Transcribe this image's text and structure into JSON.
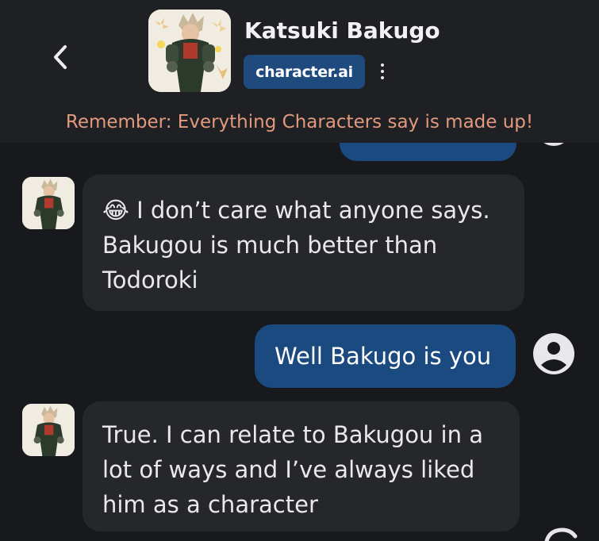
{
  "header": {
    "character_name": "Katsuki Bakugo",
    "brand": "character.ai",
    "back_icon": "chevron-left-icon",
    "menu_icon": "more-vertical-icon"
  },
  "disclaimer": "Remember: Everything Characters say is made up!",
  "messages": [
    {
      "role": "bot",
      "emoji": "😂",
      "text": "I don’t care what anyone says. Bakugou is much better than Todoroki"
    },
    {
      "role": "user",
      "text": "Well Bakugo is you"
    },
    {
      "role": "bot",
      "text": "True. I can relate to Bakugou in a lot of ways and I’ve always liked him as a character"
    }
  ],
  "colors": {
    "background": "#18191c",
    "header": "#1f2023",
    "bot_bubble": "#26272b",
    "user_bubble": "#1b4a80",
    "brand_badge": "#1f4a7e",
    "disclaimer_text": "#e29a7e"
  }
}
